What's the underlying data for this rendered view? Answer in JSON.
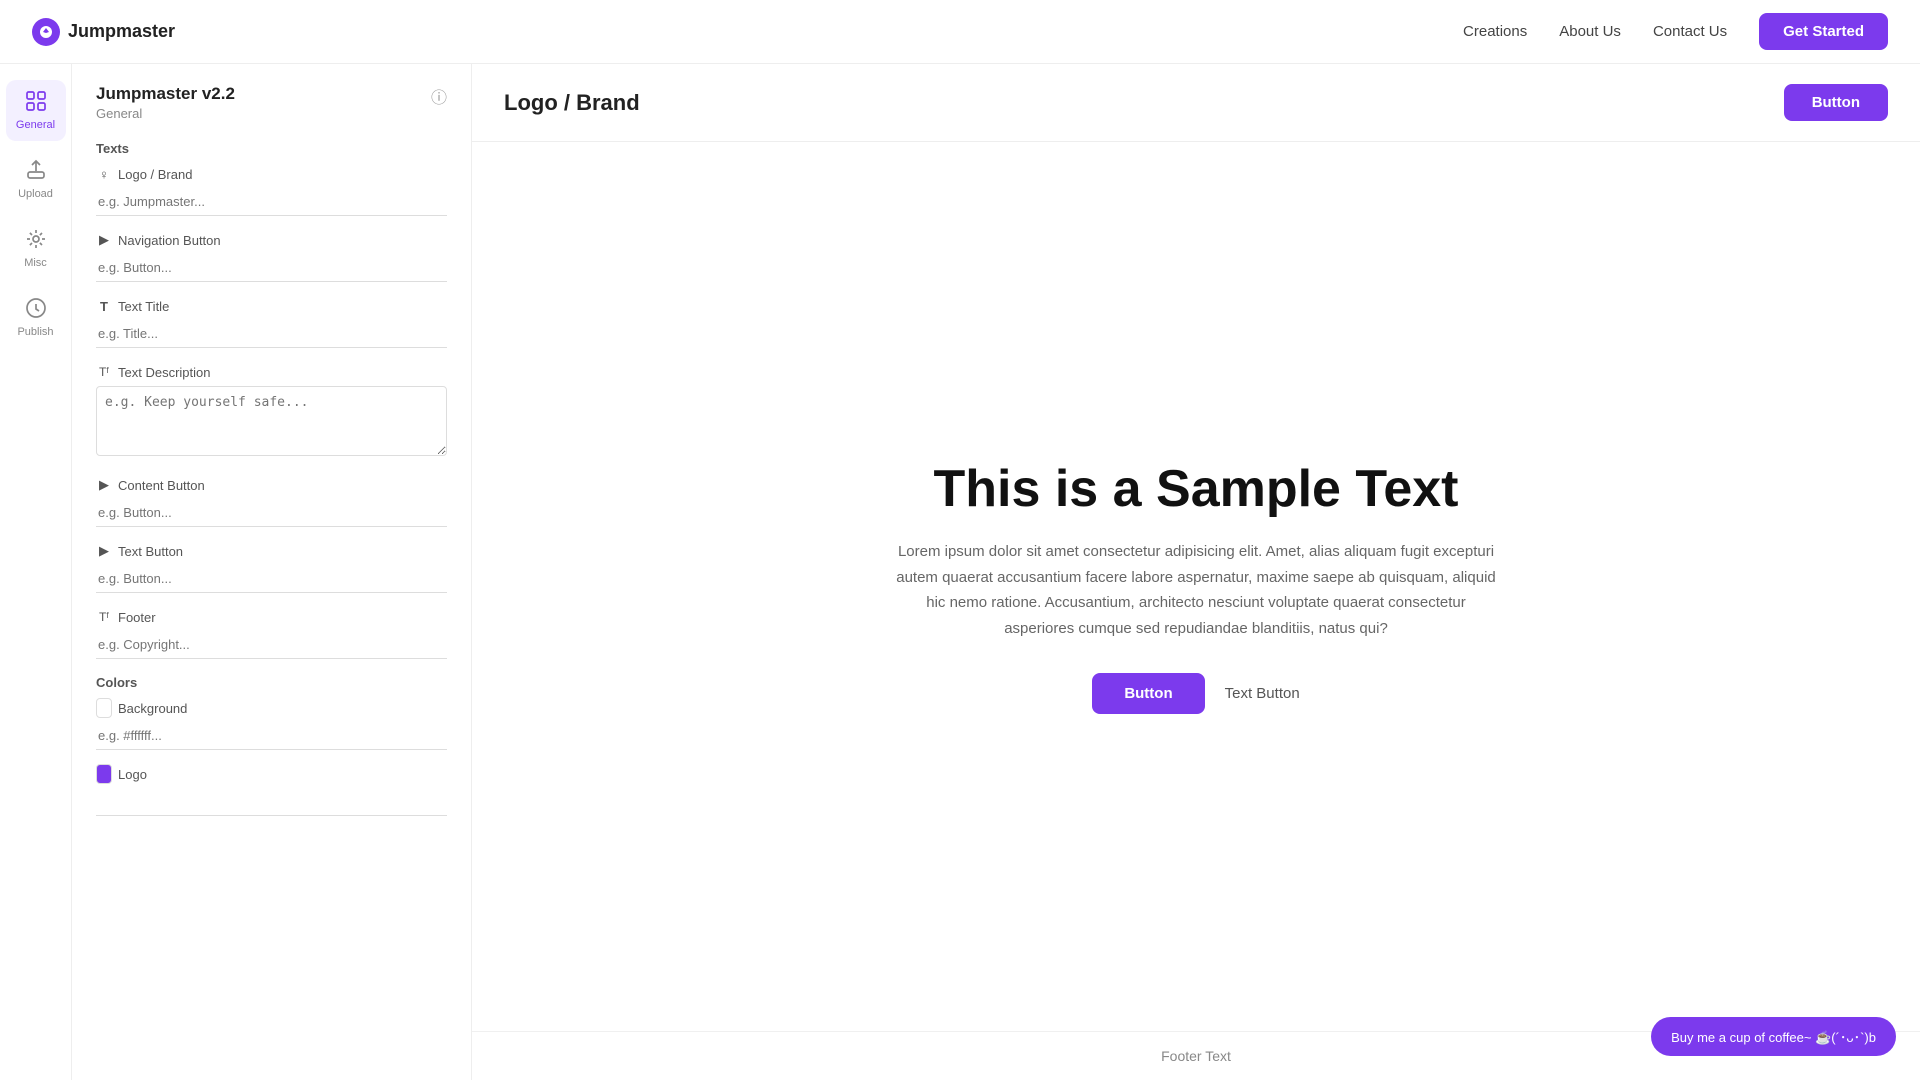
{
  "topnav": {
    "logo_text": "Jumpmaster",
    "links": [
      {
        "id": "creations",
        "label": "Creations"
      },
      {
        "id": "about",
        "label": "About Us"
      },
      {
        "id": "contact",
        "label": "Contact Us"
      }
    ],
    "cta_label": "Get Started"
  },
  "sidebar_icons": [
    {
      "id": "general",
      "label": "General",
      "active": true
    },
    {
      "id": "upload",
      "label": "Upload",
      "active": false
    },
    {
      "id": "misc",
      "label": "Misc",
      "active": false
    },
    {
      "id": "publish",
      "label": "Publish",
      "active": false
    }
  ],
  "settings": {
    "title": "Jumpmaster v2.2",
    "subtitle": "General",
    "sections": {
      "texts_label": "Texts",
      "fields": [
        {
          "id": "logo_brand",
          "label": "Logo / Brand",
          "type": "input",
          "placeholder": "e.g. Jumpmaster...",
          "icon_type": "logo"
        },
        {
          "id": "nav_button",
          "label": "Navigation Button",
          "type": "input",
          "placeholder": "e.g. Button...",
          "icon_type": "arrow"
        },
        {
          "id": "text_title",
          "label": "Text Title",
          "type": "input",
          "placeholder": "e.g. Title...",
          "icon_type": "T"
        },
        {
          "id": "text_description",
          "label": "Text Description",
          "type": "textarea",
          "placeholder": "e.g. Keep yourself safe...",
          "icon_type": "Tf"
        },
        {
          "id": "content_button",
          "label": "Content Button",
          "type": "input",
          "placeholder": "e.g. Button...",
          "icon_type": "arrow"
        },
        {
          "id": "text_button",
          "label": "Text Button",
          "type": "input",
          "placeholder": "e.g. Button...",
          "icon_type": "arrow"
        },
        {
          "id": "footer",
          "label": "Footer",
          "type": "input",
          "placeholder": "e.g. Copyright...",
          "icon_type": "Tf"
        }
      ],
      "colors_label": "Colors",
      "color_fields": [
        {
          "id": "background",
          "label": "Background",
          "type": "input",
          "placeholder": "e.g. #ffffff...",
          "icon_type": "color"
        },
        {
          "id": "logo_color",
          "label": "Logo",
          "type": "input",
          "placeholder": "",
          "icon_type": "color"
        }
      ]
    }
  },
  "preview": {
    "brand": "Logo / Brand",
    "nav_button_label": "Button",
    "hero_title": "This is a Sample Text",
    "hero_description": "Lorem ipsum dolor sit amet consectetur adipisicing elit. Amet, alias aliquam fugit excepturi autem quaerat accusantium facere labore aspernatur, maxime saepe ab quisquam, aliquid hic nemo ratione. Accusantium, architecto nesciunt voluptate quaerat consectetur asperiores cumque sed repudiandae blanditiis, natus qui?",
    "content_button_label": "Button",
    "text_button_label": "Text Button",
    "footer_text": "Footer Text"
  },
  "floating": {
    "label": "Buy me a cup of coffee~ ☕(´･ᴗ･`)b"
  }
}
